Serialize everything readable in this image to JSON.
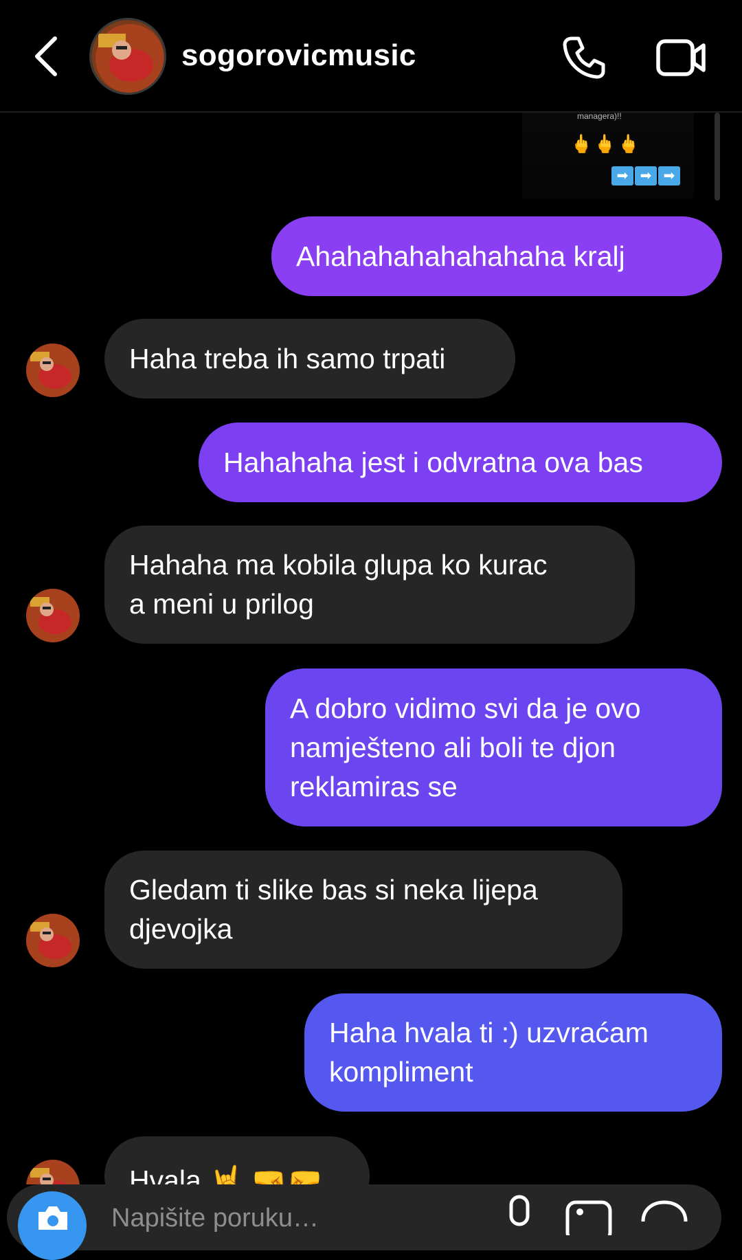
{
  "header": {
    "back_icon": "chevron-left-icon",
    "username": "sogorovicmusic",
    "call_icon": "phone-icon",
    "video_icon": "video-camera-icon"
  },
  "shared_post": {
    "caption": "managera)!!",
    "emoji": "🖕🖕🖕",
    "arrows": [
      "➡",
      "➡",
      "➡"
    ]
  },
  "messages": [
    {
      "from": "me",
      "lines": [
        "Ahahahahahahahaha kralj"
      ],
      "color": "#8b3ff2"
    },
    {
      "from": "them",
      "lines": [
        "Haha treba ih samo trpati"
      ]
    },
    {
      "from": "me",
      "lines": [
        "Hahahaha jest i odvratna ova bas"
      ],
      "color": "#7d3ff2"
    },
    {
      "from": "them",
      "lines": [
        "Hahaha ma kobila glupa ko kurac",
        "a meni u prilog"
      ]
    },
    {
      "from": "me",
      "lines": [
        "A dobro vidimo svi da je ovo",
        "namješteno ali boli te djon",
        "reklamiras se"
      ],
      "color": "#6b46f0"
    },
    {
      "from": "them",
      "lines": [
        "Gledam ti slike bas si neka lijepa",
        "djevojka"
      ]
    },
    {
      "from": "me",
      "lines": [
        "Haha hvala ti :) uzvraćam",
        "kompliment"
      ],
      "color": "#5558ee"
    },
    {
      "from": "them",
      "lines": [
        "Hvala 🤘 🤜🤛"
      ]
    }
  ],
  "composer": {
    "placeholder": "Napišite poruku…",
    "camera_icon": "camera-icon",
    "mic_icon": "microphone-icon",
    "gallery_icon": "image-icon",
    "sticker_icon": "sticker-icon"
  },
  "colors": {
    "background": "#000000",
    "incoming_bubble": "#262626",
    "accent_blue": "#3797f0"
  }
}
